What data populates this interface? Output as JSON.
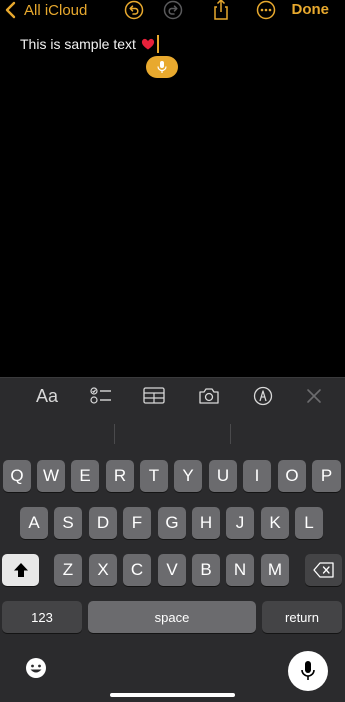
{
  "nav": {
    "back_label": "All iCloud",
    "done_label": "Done",
    "accent_color": "#E8A92E"
  },
  "note": {
    "text": "This is sample text",
    "emoji": "heart"
  },
  "toolbar": {
    "format_label": "Aa",
    "items": [
      "format",
      "checklist",
      "table",
      "camera",
      "markup",
      "close"
    ]
  },
  "keyboard": {
    "row1": [
      "Q",
      "W",
      "E",
      "R",
      "T",
      "Y",
      "U",
      "I",
      "O",
      "P"
    ],
    "row2": [
      "A",
      "S",
      "D",
      "F",
      "G",
      "H",
      "J",
      "K",
      "L"
    ],
    "row3": [
      "Z",
      "X",
      "C",
      "V",
      "B",
      "N",
      "M"
    ],
    "numbers_label": "123",
    "space_label": "space",
    "return_label": "return"
  }
}
